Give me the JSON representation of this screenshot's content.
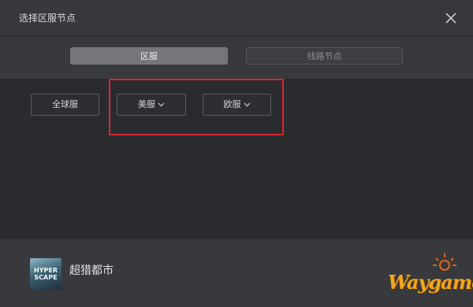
{
  "dialog": {
    "title": "选择区服节点",
    "close_icon": "close-icon"
  },
  "tabs": [
    {
      "label": "区服",
      "active": true
    },
    {
      "label": "线路节点",
      "active": false
    }
  ],
  "regions": [
    {
      "label": "全球服",
      "has_dropdown": false
    },
    {
      "label": "美服",
      "has_dropdown": true
    },
    {
      "label": "欧服",
      "has_dropdown": true
    }
  ],
  "annotation": {
    "color": "#d7262e"
  },
  "game": {
    "name": "超猎都市",
    "icon_text_1": "HYPER",
    "icon_text_2": "SCAPE",
    "icon": "game-icon"
  },
  "watermark": {
    "text": "Waygamer",
    "color": "#f0a81c"
  }
}
